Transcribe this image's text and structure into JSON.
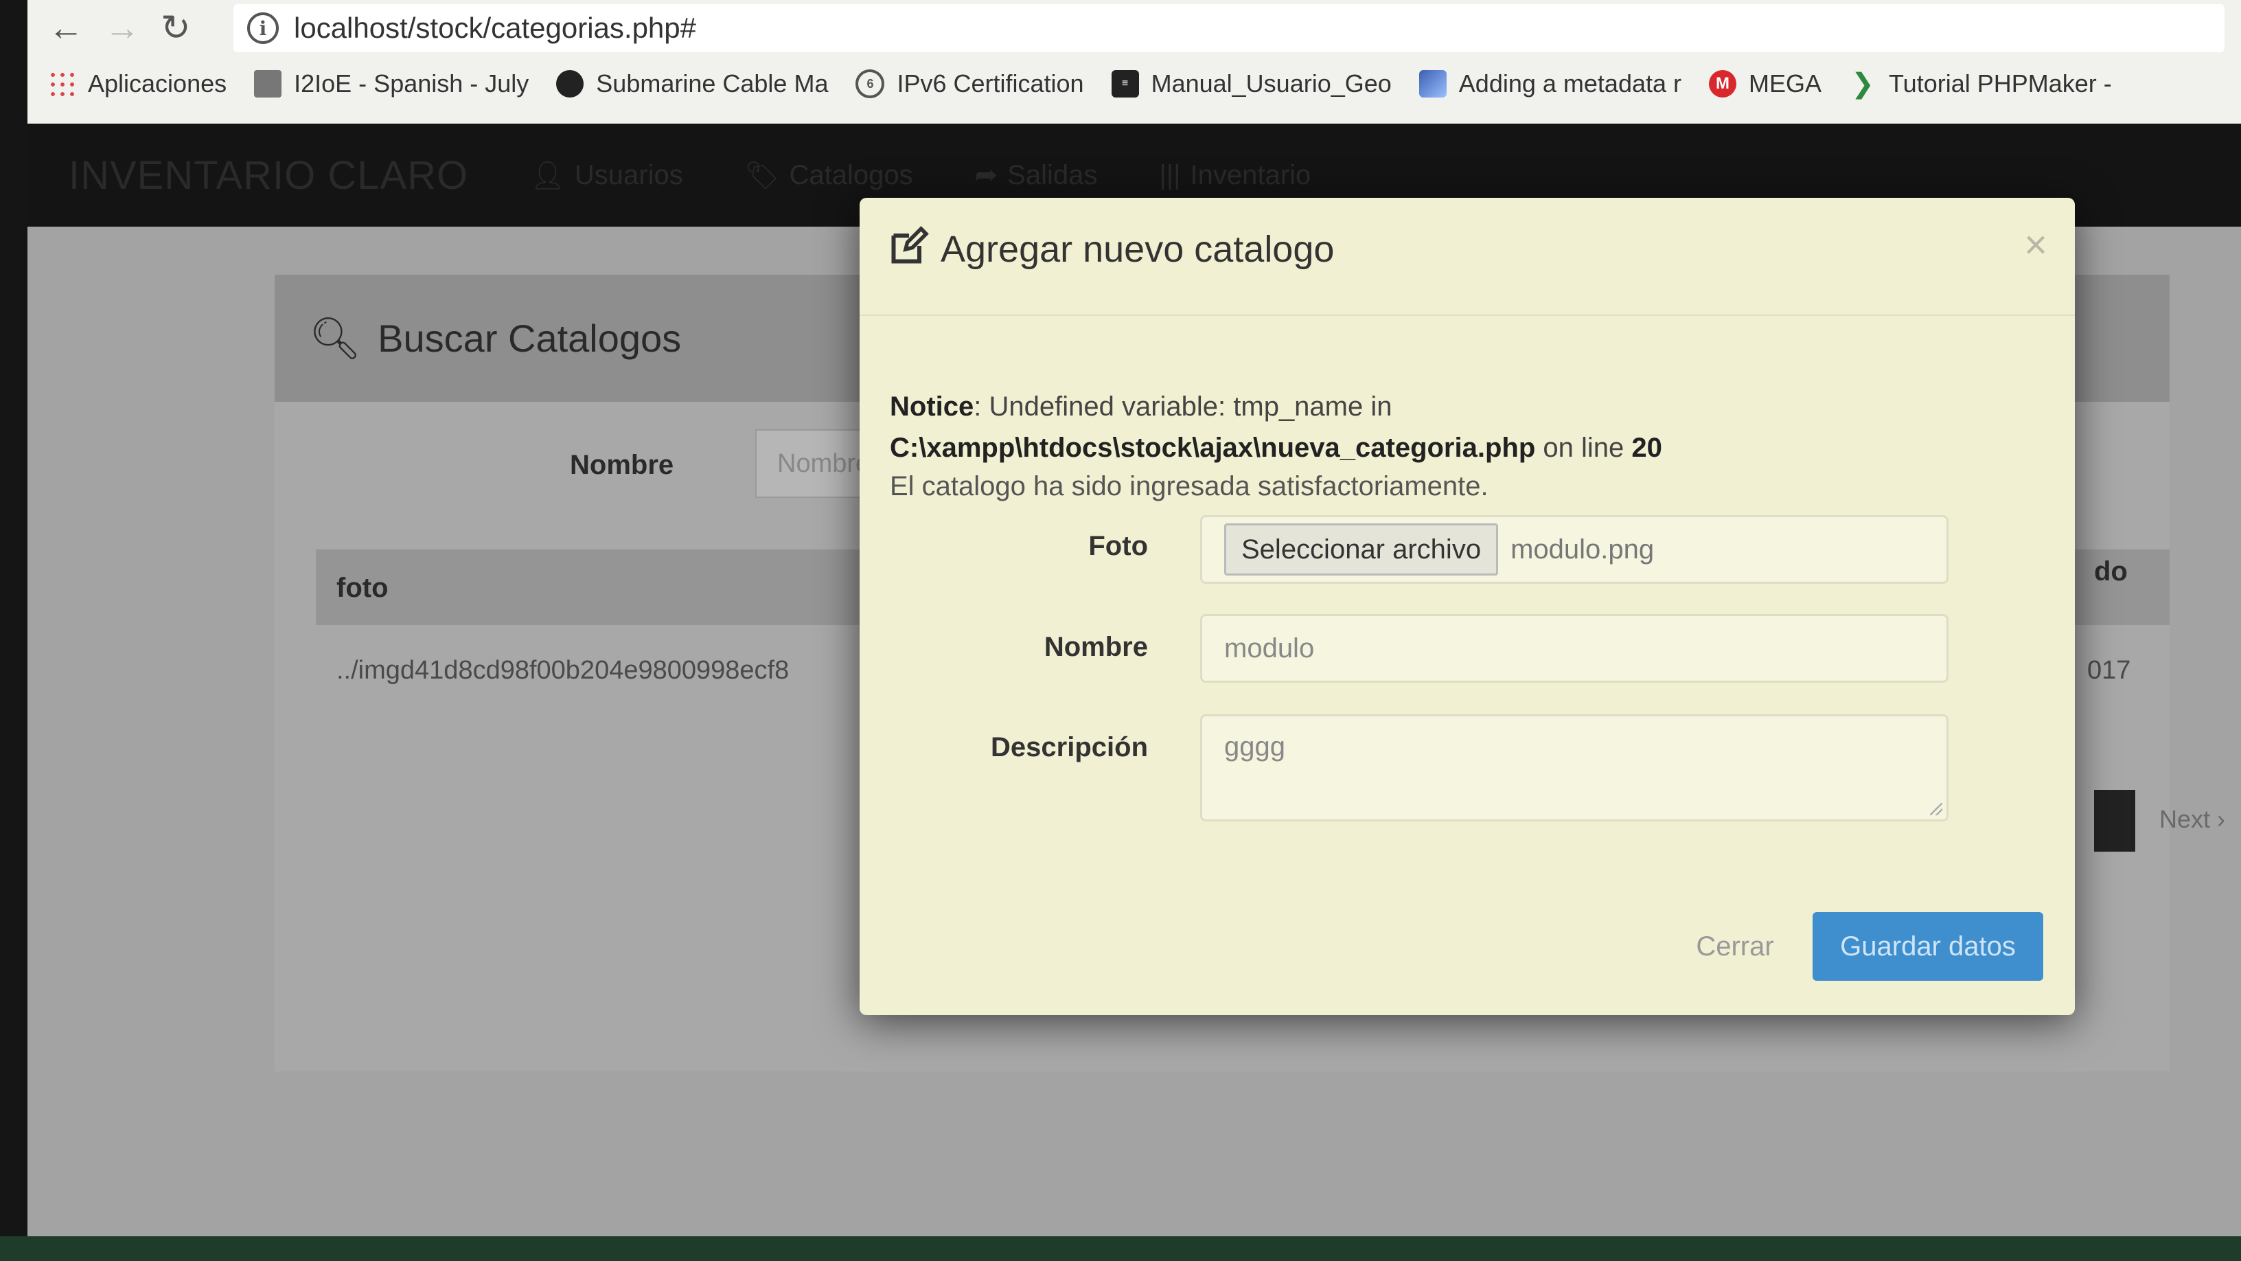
{
  "browser": {
    "url": "localhost/stock/categorias.php#",
    "bookmarks": [
      {
        "label": "Aplicaciones",
        "icon": "apps-grid-icon"
      },
      {
        "label": "I2IoE - Spanish - July",
        "icon": "folder-icon"
      },
      {
        "label": "Submarine Cable Ma",
        "icon": "globe-icon"
      },
      {
        "label": "IPv6 Certification",
        "icon": "ipv6-icon"
      },
      {
        "label": "Manual_Usuario_Geo",
        "icon": "document-icon"
      },
      {
        "label": "Adding a metadata r",
        "icon": "image-icon"
      },
      {
        "label": "MEGA",
        "icon": "mega-icon"
      },
      {
        "label": "Tutorial PHPMaker -",
        "icon": "leaf-icon"
      }
    ]
  },
  "app": {
    "brand": "INVENTARIO CLARO",
    "menu": [
      {
        "label": "Usuarios",
        "icon": "user-icon"
      },
      {
        "label": "Catalogos",
        "icon": "tag-icon"
      },
      {
        "label": "Salidas",
        "icon": "share-icon"
      },
      {
        "label": "Inventario",
        "icon": "barcode-icon"
      }
    ],
    "panel_title": "Buscar Catalogos",
    "filter_label": "Nombre",
    "filter_placeholder": "Nombre",
    "table": {
      "col_foto": "foto",
      "col_right": "do",
      "row_path": "../imgd41d8cd98f00b204e9800998ecf8",
      "row_right": "017"
    },
    "pager_next": "Next ›"
  },
  "modal": {
    "title": "Agregar nuevo catalogo",
    "close_glyph": "×",
    "notice": {
      "label": "Notice",
      "message": ": Undefined variable: tmp_name in",
      "path": "C:\\xampp\\htdocs\\stock\\ajax\\nueva_categoria.php",
      "on_line_text": " on line ",
      "line": "20"
    },
    "success": "El catalogo ha sido ingresada satisfactoriamente.",
    "fields": {
      "foto_label": "Foto",
      "file_button": "Seleccionar archivo",
      "file_name": "modulo.png",
      "nombre_label": "Nombre",
      "nombre_value": "modulo",
      "descripcion_label": "Descripción",
      "descripcion_value": "gggg"
    },
    "buttons": {
      "cerrar": "Cerrar",
      "guardar": "Guardar datos"
    }
  },
  "colors": {
    "modal_bg": "#f2f0d2",
    "primary": "#3f8fcf",
    "navbar": "#141414"
  }
}
